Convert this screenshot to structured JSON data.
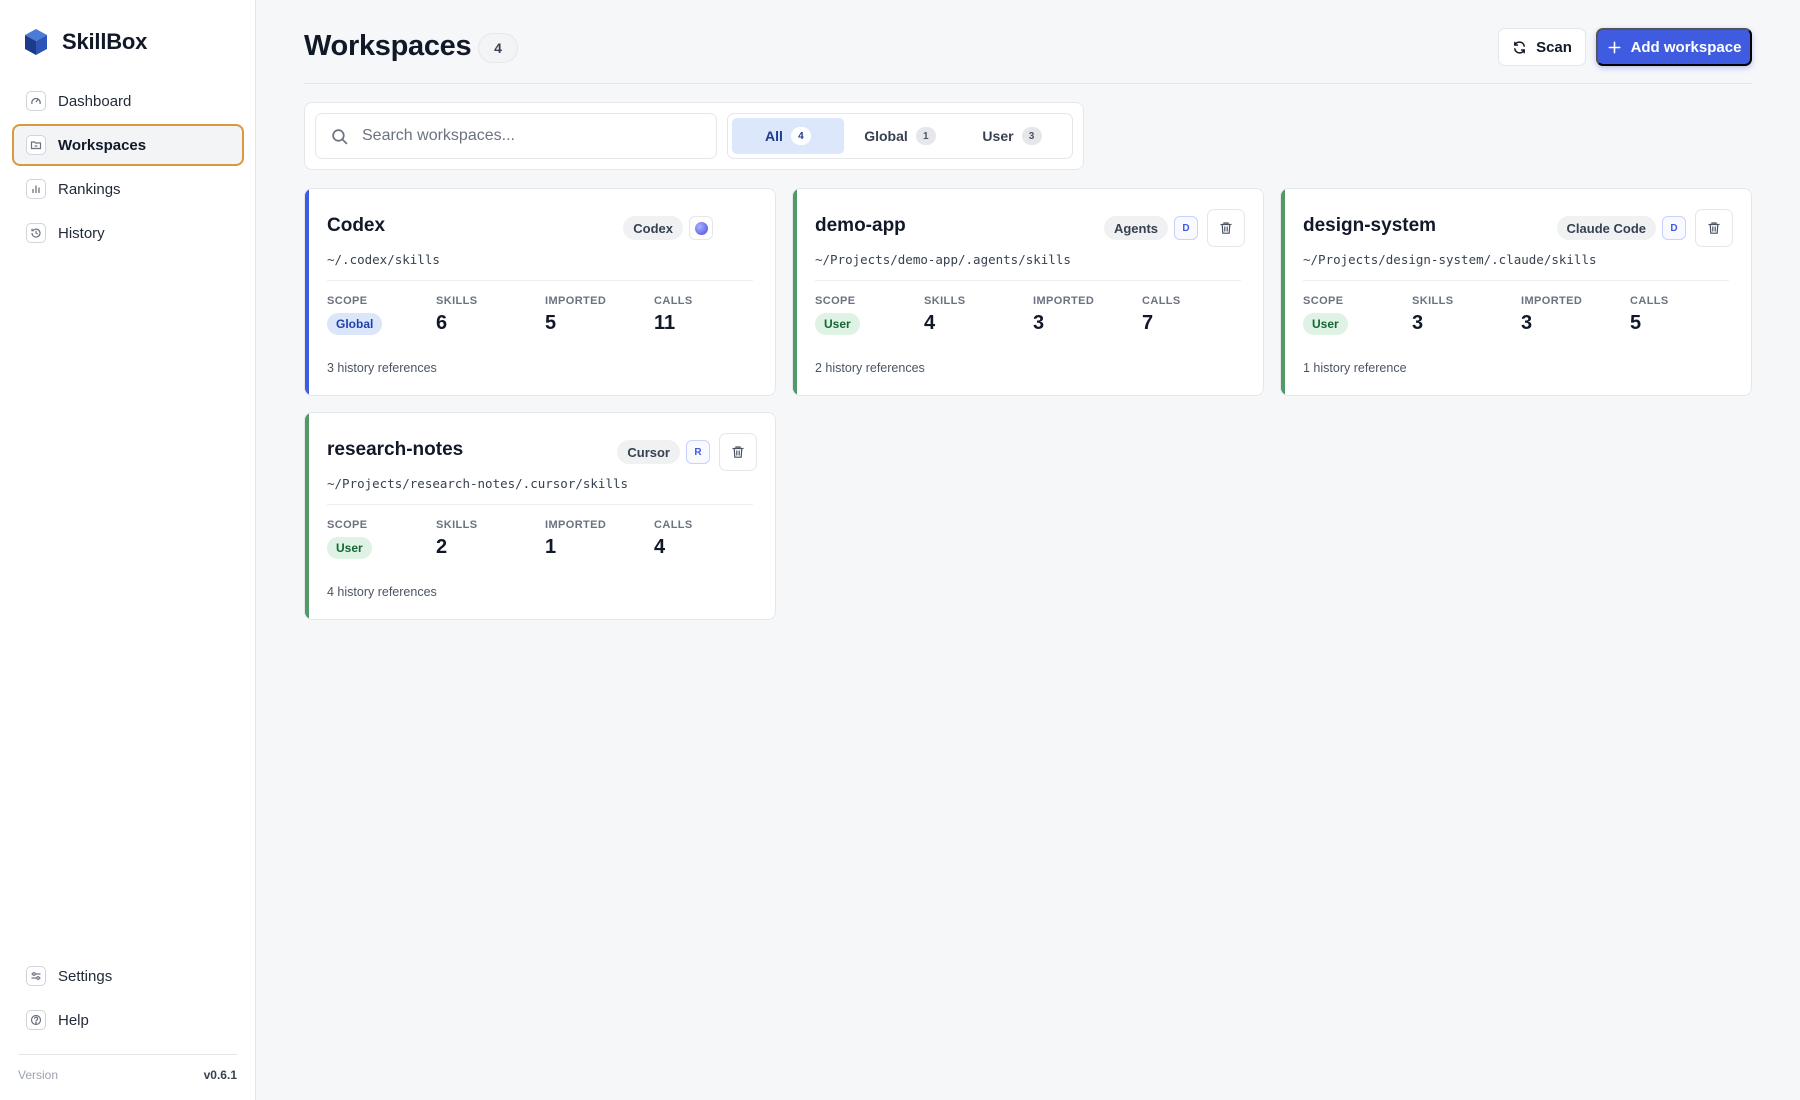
{
  "app": {
    "name": "SkillBox"
  },
  "colors": {
    "accent": "#3f5ce0",
    "global_accent": "#3f5ce0",
    "user_accent": "#4f9a66",
    "active_nav_border": "#d89a3c"
  },
  "sidebar": {
    "items": [
      {
        "label": "Dashboard",
        "icon": "gauge-icon",
        "active": false
      },
      {
        "label": "Workspaces",
        "icon": "folder-icon",
        "active": true
      },
      {
        "label": "Rankings",
        "icon": "bar-chart-icon",
        "active": false
      },
      {
        "label": "History",
        "icon": "history-icon",
        "active": false
      }
    ],
    "bottom_items": [
      {
        "label": "Settings",
        "icon": "sliders-icon"
      },
      {
        "label": "Help",
        "icon": "help-icon"
      }
    ],
    "version_label": "Version",
    "version_value": "v0.6.1"
  },
  "header": {
    "title": "Workspaces",
    "count": "4",
    "scan_label": "Scan",
    "add_label": "Add workspace"
  },
  "toolbar": {
    "search_placeholder": "Search workspaces...",
    "filters": [
      {
        "label": "All",
        "count": "4",
        "active": true
      },
      {
        "label": "Global",
        "count": "1",
        "active": false
      },
      {
        "label": "User",
        "count": "3",
        "active": false
      }
    ]
  },
  "stat_labels": {
    "scope": "SCOPE",
    "skills": "SKILLS",
    "imported": "IMPORTED",
    "calls": "CALLS"
  },
  "workspaces": [
    {
      "name": "Codex",
      "agent": "Codex",
      "avatar": "",
      "avatar_icon": "codex-logo-icon",
      "deletable": false,
      "path": "~/.codex/skills",
      "scope": "Global",
      "skills": "6",
      "imported": "5",
      "calls": "11",
      "history": "3 history references"
    },
    {
      "name": "demo-app",
      "agent": "Agents",
      "avatar": "D",
      "deletable": true,
      "path": "~/Projects/demo-app/.agents/skills",
      "scope": "User",
      "skills": "4",
      "imported": "3",
      "calls": "7",
      "history": "2 history references"
    },
    {
      "name": "design-system",
      "agent": "Claude Code",
      "avatar": "D",
      "deletable": true,
      "path": "~/Projects/design-system/.claude/skills",
      "scope": "User",
      "skills": "3",
      "imported": "3",
      "calls": "5",
      "history": "1 history reference"
    },
    {
      "name": "research-notes",
      "agent": "Cursor",
      "avatar": "R",
      "deletable": true,
      "path": "~/Projects/research-notes/.cursor/skills",
      "scope": "User",
      "skills": "2",
      "imported": "1",
      "calls": "4",
      "history": "4 history references"
    }
  ]
}
